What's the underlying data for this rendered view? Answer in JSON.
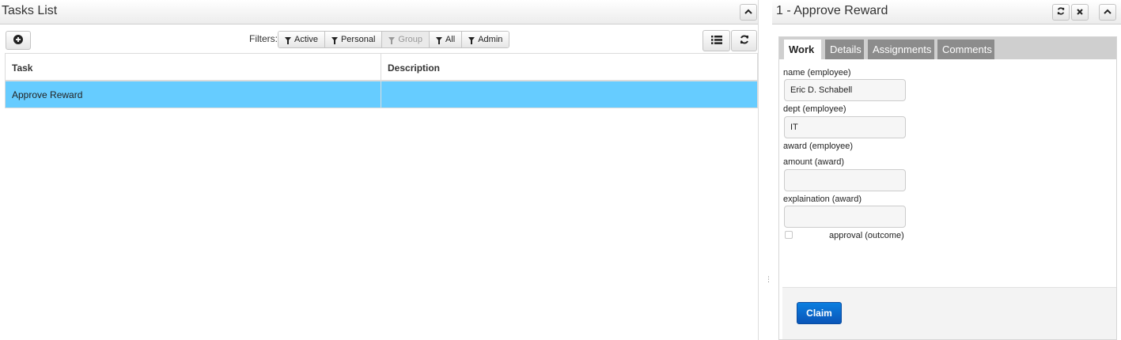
{
  "tasks_panel": {
    "title": "Tasks List",
    "filters_label": "Filters:",
    "filters": [
      {
        "label": "Active",
        "icon": "filter-icon",
        "enabled": true
      },
      {
        "label": "Personal",
        "icon": "filter-icon",
        "enabled": true
      },
      {
        "label": "Group",
        "icon": "filter-icon",
        "enabled": false
      },
      {
        "label": "All",
        "icon": "filter-icon",
        "enabled": true
      },
      {
        "label": "Admin",
        "icon": "filter-icon",
        "enabled": true
      }
    ],
    "columns": [
      "Task",
      "Description"
    ],
    "rows": [
      {
        "task": "Approve Reward",
        "description": "",
        "selected": true
      }
    ],
    "selected_row_color": "#66ccff"
  },
  "task_panel": {
    "title": "1 - Approve Reward",
    "tabs": [
      {
        "label": "Work",
        "active": true
      },
      {
        "label": "Details",
        "active": false
      },
      {
        "label": "Assignments",
        "active": false
      },
      {
        "label": "Comments",
        "active": false
      }
    ],
    "form": {
      "name_label": "name (employee)",
      "name_value": "Eric D. Schabell",
      "dept_label": "dept (employee)",
      "dept_value": "IT",
      "award_label": "award (employee)",
      "amount_label": "amount (award)",
      "amount_value": "",
      "explaination_label": "explaination (award)",
      "explaination_value": "",
      "approval_label": "approval (outcome)",
      "approval_checked": false
    },
    "claim_label": "Claim",
    "claim_color": "#0a6fd6"
  }
}
